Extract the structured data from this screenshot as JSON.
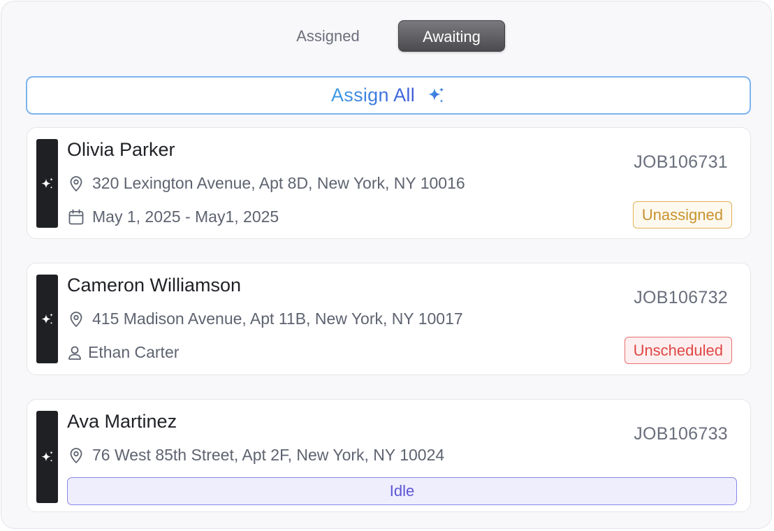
{
  "tabs": {
    "assigned": "Assigned",
    "awaiting": "Awaiting",
    "active": "Awaiting"
  },
  "assign_all": {
    "label": "Assign All",
    "icon": "sparkle-icon"
  },
  "jobs": [
    {
      "name": "Olivia Parker",
      "job_id": "JOB106731",
      "address": "320 Lexington Avenue, Apt 8D, New York, NY 10016",
      "date_range": "May 1, 2025 - May1, 2025",
      "status": "Unassigned",
      "status_color": "#c8922e"
    },
    {
      "name": "Cameron Williamson",
      "job_id": "JOB106732",
      "address": "415 Madison Avenue, Apt 11B, New York, NY 10017",
      "assignee": "Ethan Carter",
      "status": "Unscheduled",
      "status_color": "#e04646"
    },
    {
      "name": "Ava Martinez",
      "job_id": "JOB106733",
      "address": "76 West 85th Street, Apt 2F, New York, NY 10024",
      "status": "Idle",
      "status_color": "#5b55d6"
    }
  ],
  "colors": {
    "accent_blue": "#3b9de6",
    "card_bar": "#1f2023",
    "tab_active_bg": "#5a5a5e"
  }
}
